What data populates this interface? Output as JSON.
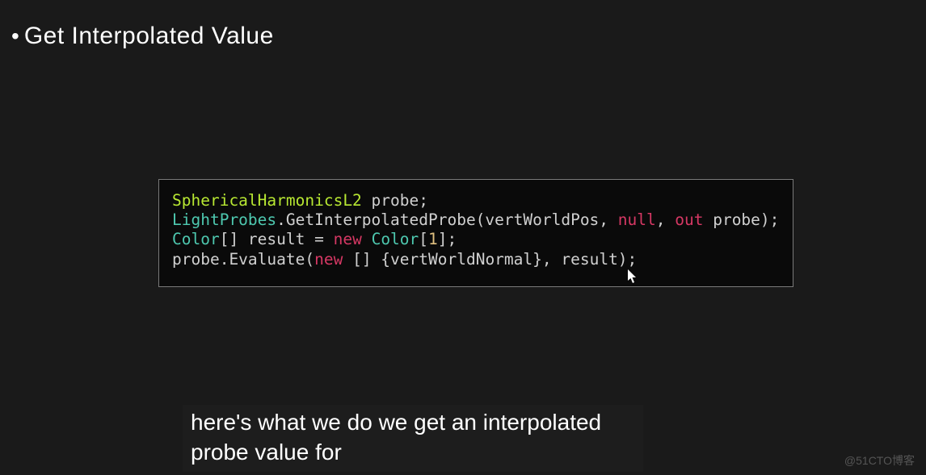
{
  "header": {
    "bullet": "•",
    "title": "Get Interpolated Value"
  },
  "code": {
    "line1": {
      "type": "SphericalHarmonicsL2",
      "rest": " probe;"
    },
    "line2": {
      "class": "LightProbes",
      "dot_method": ".GetInterpolatedProbe(vertWorldPos, ",
      "null_kw": "null",
      "comma": ", ",
      "out_kw": "out",
      "rest": " probe);"
    },
    "line3": {
      "type": "Color",
      "brackets": "[] result = ",
      "new_kw": "new",
      "space": " ",
      "type2": "Color",
      "open": "[",
      "num": "1",
      "close": "];"
    },
    "line4": {
      "start": "probe.Evaluate(",
      "new_kw": "new",
      "rest": " [] {vertWorldNormal}, result);"
    }
  },
  "caption": {
    "text": "here's what we do we get an interpolated probe value for"
  },
  "watermark": {
    "text": "@51CTO博客"
  },
  "cursor": {
    "glyph": "➤"
  }
}
